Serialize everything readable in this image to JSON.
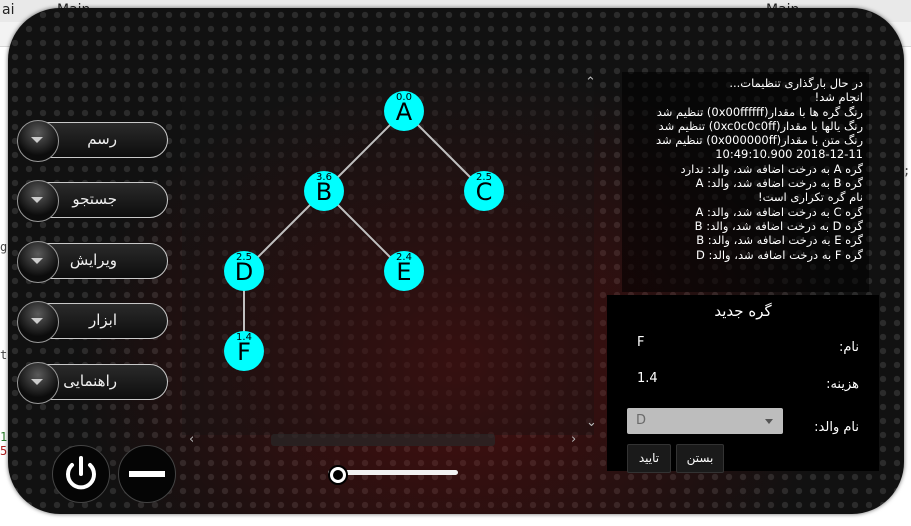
{
  "browser": {
    "tab1": "ai",
    "tab2": "Main",
    "tab3": "Main"
  },
  "background_fragments": [
    "g",
    "t.",
    "17",
    "56",
    ";"
  ],
  "menu": {
    "items": [
      {
        "label": "رسم"
      },
      {
        "label": "جستجو"
      },
      {
        "label": "ویرایش"
      },
      {
        "label": "ابزار"
      },
      {
        "label": "راهنمایی"
      }
    ]
  },
  "tree": {
    "nodes": [
      {
        "name": "A",
        "cost": "0.0",
        "parent": ""
      },
      {
        "name": "B",
        "cost": "3.6",
        "parent": "A"
      },
      {
        "name": "C",
        "cost": "2.5",
        "parent": "A"
      },
      {
        "name": "D",
        "cost": "2.5",
        "parent": "B"
      },
      {
        "name": "E",
        "cost": "2.4",
        "parent": "B"
      },
      {
        "name": "F",
        "cost": "1.4",
        "parent": "D"
      }
    ],
    "node_color": "#00ffff",
    "edge_color": "#c0c0c0",
    "text_color": "#000000"
  },
  "log": {
    "lines": [
      "در حال بارگذاری تنظیمات...",
      "انجام شد!",
      "رنگ گره ها با مقدار(0x00ffffff) تنظیم شد",
      "رنگ یالها با مقدار(0xc0c0c0ff) تنظیم شد",
      "رنگ متن با مقدار(0x000000ff) تنظیم شد",
      "2018-12-11     10:49:10.900",
      "گره A به درخت اضافه شد،  والد: ندارد",
      "گره B به درخت اضافه شد،  والد: A",
      "نام گره تکراری است!",
      "گره C به درخت اضافه شد،  والد: A",
      "گره D به درخت اضافه شد،  والد: B",
      "گره E به درخت اضافه شد،  والد: B",
      "گره F به درخت اضافه شد،  والد: D"
    ]
  },
  "form": {
    "title": "گره جدید",
    "name_label": "نام:",
    "name_value": "F",
    "cost_label": "هزینه:",
    "cost_value": "1.4",
    "parent_label": "نام والد:",
    "parent_value": "D",
    "confirm_label": "تایید",
    "close_label": "بستن"
  },
  "slider": {
    "value": 0
  }
}
